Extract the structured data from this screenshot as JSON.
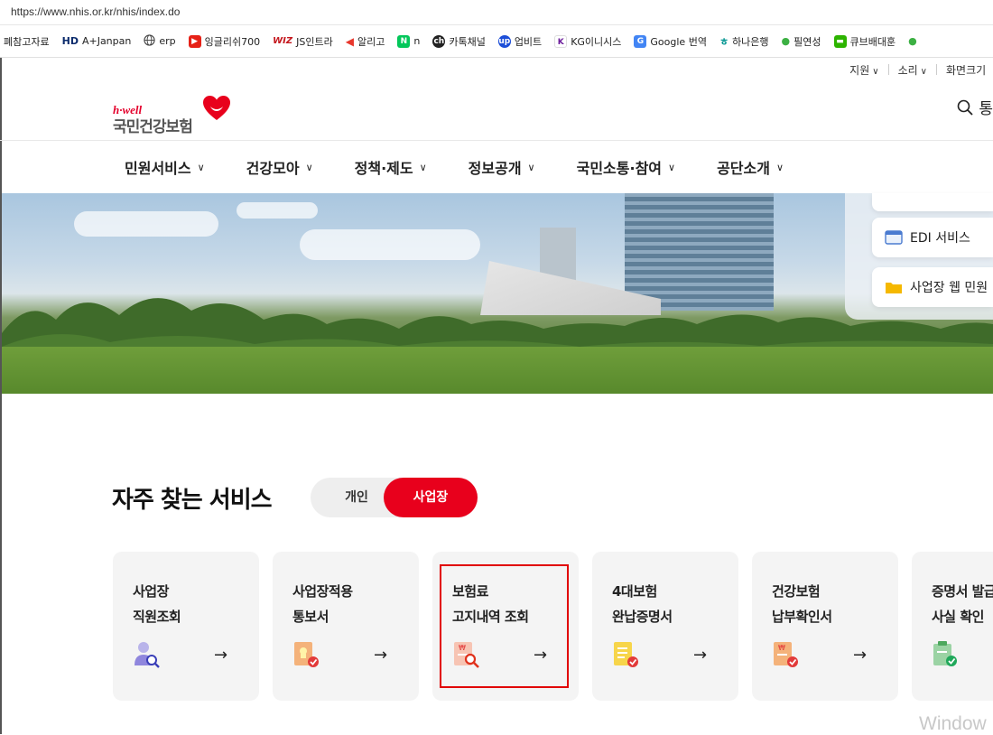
{
  "browser": {
    "url": "https://www.nhis.or.kr/nhis/index.do"
  },
  "bookmarks": [
    {
      "label": "폐참고자료",
      "icon": "folder-icon",
      "color": ""
    },
    {
      "label": "A+Janpan",
      "icon": "hd-icon",
      "color": "#0a2a6b"
    },
    {
      "label": "erp",
      "icon": "globe-icon",
      "color": "#555555"
    },
    {
      "label": "잉글리쉬700",
      "icon": "youtube-icon",
      "color": "#e62117"
    },
    {
      "label": "JS인트라",
      "icon": "wiz-icon",
      "color": "#c4161c"
    },
    {
      "label": "알리고",
      "icon": "aligo-icon",
      "color": "#e8372c"
    },
    {
      "label": "n",
      "icon": "naver-icon",
      "color": "#03c75a"
    },
    {
      "label": "카톡채널",
      "icon": "kakao-channel-icon",
      "color": "#222222"
    },
    {
      "label": "업비트",
      "icon": "upbit-icon",
      "color": "#1c4ed8"
    },
    {
      "label": "KG이니시스",
      "icon": "kg-icon",
      "color": "#6a1b9a"
    },
    {
      "label": "Google 번역",
      "icon": "google-translate-icon",
      "color": "#4285f4"
    },
    {
      "label": "하나은행",
      "icon": "hana-icon",
      "color": "#009490"
    },
    {
      "label": "필연성",
      "icon": "leaf-icon",
      "color": "#3cb043"
    },
    {
      "label": "큐브배대훈",
      "icon": "chat-icon",
      "color": "#2db400"
    }
  ],
  "utility": {
    "support": "지원",
    "sound": "소리",
    "screen": "화면크기"
  },
  "logo": {
    "tagline": "h·well",
    "name": "국민건강보험"
  },
  "header": {
    "search_label": "통"
  },
  "nav": [
    {
      "label": "민원서비스"
    },
    {
      "label": "건강모아"
    },
    {
      "label": "정책·제도"
    },
    {
      "label": "정보공개"
    },
    {
      "label": "국민소통·참여"
    },
    {
      "label": "공단소개"
    }
  ],
  "side_links": [
    {
      "label": "EDI 서비스",
      "icon": "edi-monitor-icon"
    },
    {
      "label": "사업장 웹 민원",
      "icon": "folder-icon"
    }
  ],
  "services": {
    "title": "자주 찾는 서비스",
    "toggle": {
      "personal": "개인",
      "business": "사업장",
      "active": "사업장"
    },
    "cards": [
      {
        "title": "사업장\n직원조회",
        "icon": "employee-search-icon",
        "highlighted": false
      },
      {
        "title": "사업장적용\n통보서",
        "icon": "certificate-check-icon",
        "highlighted": false
      },
      {
        "title": "보험료\n고지내역 조회",
        "icon": "notice-search-icon",
        "highlighted": true
      },
      {
        "title": "4대보험\n완납증명서",
        "icon": "document-check-icon",
        "highlighted": false
      },
      {
        "title": "건강보험\n납부확인서",
        "icon": "payment-check-icon",
        "highlighted": false
      },
      {
        "title": "증명서 발급\n사실 확인",
        "icon": "clipboard-check-icon",
        "highlighted": false
      }
    ],
    "arrow": "→"
  },
  "os": {
    "watermark": "Window"
  }
}
